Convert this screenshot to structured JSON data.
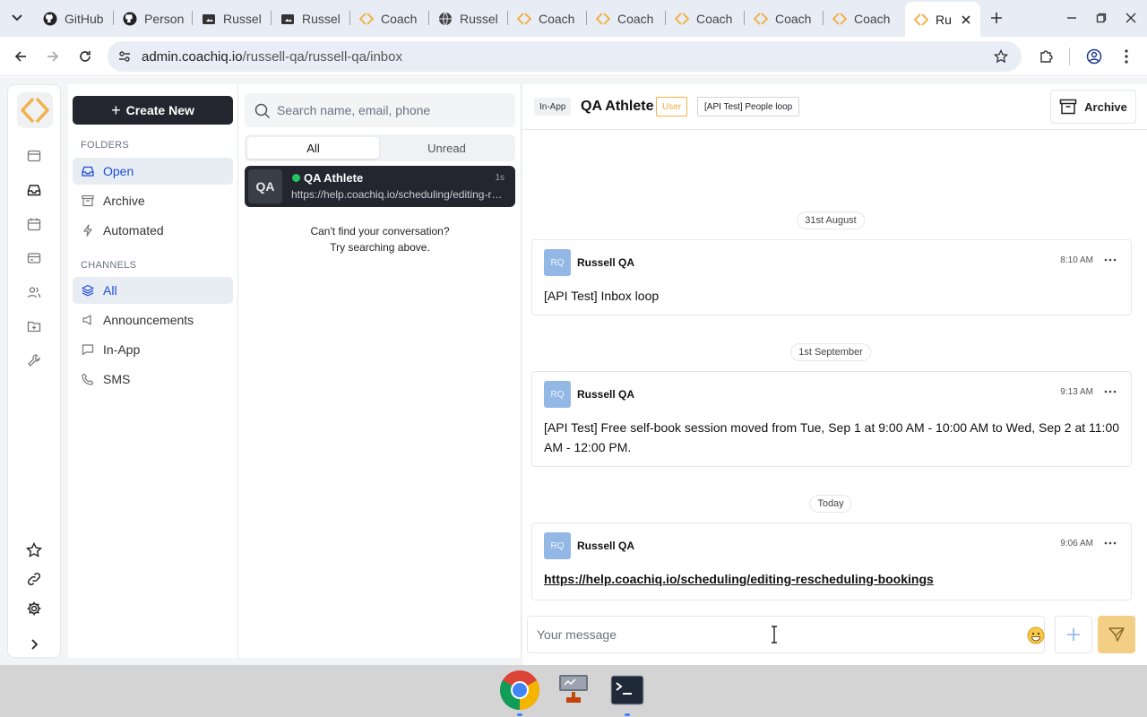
{
  "browser": {
    "tabs": [
      {
        "title": "GitHub",
        "favicon": "github-icon"
      },
      {
        "title": "Person",
        "favicon": "github-icon"
      },
      {
        "title": "Russel",
        "favicon": "document-icon"
      },
      {
        "title": "Russel",
        "favicon": "document-icon"
      },
      {
        "title": "Coach",
        "favicon": "coachiq-icon"
      },
      {
        "title": "Russel",
        "favicon": "globe-icon"
      },
      {
        "title": "Coach",
        "favicon": "coachiq-icon"
      },
      {
        "title": "Coach",
        "favicon": "coachiq-icon"
      },
      {
        "title": "Coach",
        "favicon": "coachiq-icon"
      },
      {
        "title": "Coach",
        "favicon": "coachiq-icon"
      },
      {
        "title": "Coach",
        "favicon": "coachiq-icon"
      }
    ],
    "active_tab": {
      "title": "Ru",
      "favicon": "coachiq-icon"
    },
    "url_host": "admin.coachiq.io",
    "url_path": "/russell-qa/russell-qa/inbox"
  },
  "sidebar": {
    "create_label": "Create New",
    "folders_heading": "FOLDERS",
    "folders": [
      {
        "label": "Open",
        "icon": "inbox-icon",
        "active": true
      },
      {
        "label": "Archive",
        "icon": "archive-icon",
        "active": false
      },
      {
        "label": "Automated",
        "icon": "bolt-icon",
        "active": false
      }
    ],
    "channels_heading": "CHANNELS",
    "channels": [
      {
        "label": "All",
        "icon": "layers-icon",
        "active": true
      },
      {
        "label": "Announcements",
        "icon": "megaphone-icon",
        "active": false
      },
      {
        "label": "In-App",
        "icon": "chat-icon",
        "active": false
      },
      {
        "label": "SMS",
        "icon": "phone-icon",
        "active": false
      }
    ]
  },
  "conversations": {
    "search_placeholder": "Search name, email, phone",
    "tabs": [
      "All",
      "Unread"
    ],
    "active_tab": "All",
    "items": [
      {
        "initials": "QA",
        "name": "QA Athlete",
        "time": "1s",
        "preview": "https://help.coachiq.io/scheduling/editing-rescheduling-bookings",
        "online": true
      }
    ],
    "empty_hint_line1": "Can't find your conversation?",
    "empty_hint_line2": "Try searching above."
  },
  "chat": {
    "channel_chip": "In-App",
    "title": "QA Athlete",
    "role_chip": "User",
    "tag_chip": "[API Test] People loop",
    "archive_label": "Archive",
    "messages": [
      {
        "date": "31st August",
        "initials": "RQ",
        "sender": "Russell QA",
        "time": "8:10 AM",
        "text": "[API Test] Inbox loop",
        "is_link": false
      },
      {
        "date": "1st September",
        "initials": "RQ",
        "sender": "Russell QA",
        "time": "9:13 AM",
        "text": "[API Test] Free self-book session moved from Tue, Sep 1 at 9:00 AM - 10:00 AM to Wed, Sep 2 at 11:00 AM - 12:00 PM.",
        "is_link": false
      },
      {
        "date": "Today",
        "initials": "RQ",
        "sender": "Russell QA",
        "time": "9:06 AM",
        "text": "https://help.coachiq.io/scheduling/editing-rescheduling-bookings",
        "is_link": true
      }
    ],
    "composer_placeholder": "Your message"
  },
  "colors": {
    "primary_dark": "#23262e",
    "active_blue": "#1d4ed8",
    "online_green": "#22c55e",
    "send_yellow": "#f2cf84",
    "user_chip_orange": "#f0a53a",
    "avatar_blue": "#93b8e6"
  }
}
